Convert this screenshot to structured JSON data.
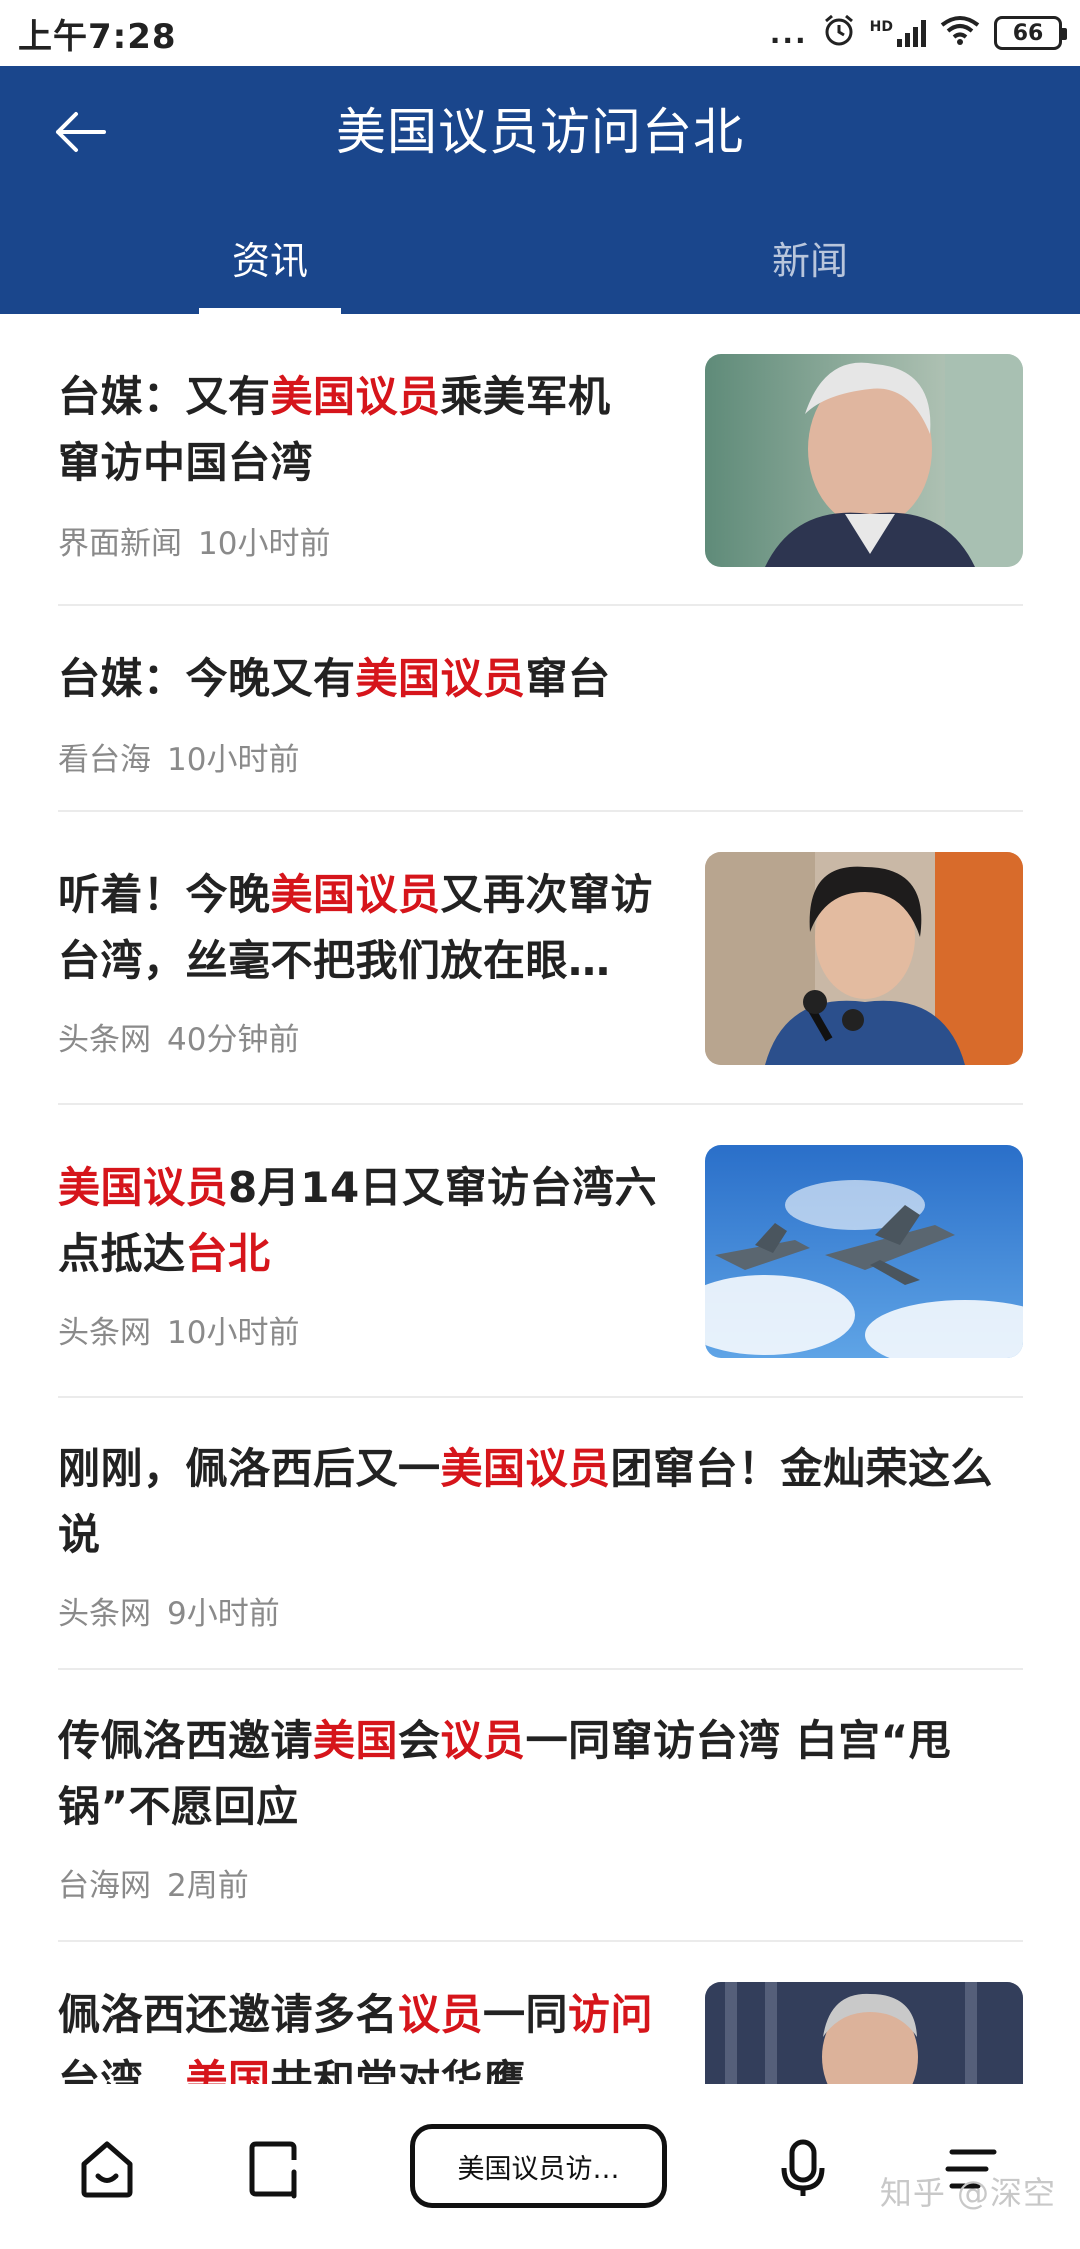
{
  "status": {
    "time": "上午7:28",
    "dots": "...",
    "hd": "HD",
    "battery": "66"
  },
  "header": {
    "title": "美国议员访问台北"
  },
  "tabs": [
    {
      "label": "资讯"
    },
    {
      "label": "新闻"
    }
  ],
  "items": [
    {
      "title_parts": [
        {
          "t": "台媒：又有",
          "h": false
        },
        {
          "t": "美国议员",
          "h": true
        },
        {
          "t": "乘美军机窜访中国台湾",
          "h": false
        }
      ],
      "source": "界面新闻",
      "time": "10小时前"
    },
    {
      "title_parts": [
        {
          "t": "台媒：今晚又有",
          "h": false
        },
        {
          "t": "美国议员",
          "h": true
        },
        {
          "t": "窜台",
          "h": false
        }
      ],
      "source": "看台海",
      "time": "10小时前"
    },
    {
      "title_parts": [
        {
          "t": "听着！今晚",
          "h": false
        },
        {
          "t": "美国议员",
          "h": true
        },
        {
          "t": "又再次窜访台湾，丝毫不把我们放在眼…",
          "h": false
        }
      ],
      "source": "头条网",
      "time": "40分钟前"
    },
    {
      "title_parts": [
        {
          "t": "美国议员",
          "h": true
        },
        {
          "t": "8月14日又窜访台湾六点抵达",
          "h": false
        },
        {
          "t": "台北",
          "h": true
        }
      ],
      "source": "头条网",
      "time": "10小时前"
    },
    {
      "title_parts": [
        {
          "t": "刚刚，佩洛西后又一",
          "h": false
        },
        {
          "t": "美国议员",
          "h": true
        },
        {
          "t": "团窜台！金灿荣这么说",
          "h": false
        }
      ],
      "source": "头条网",
      "time": "9小时前"
    },
    {
      "title_parts": [
        {
          "t": "传佩洛西邀请",
          "h": false
        },
        {
          "t": "美国",
          "h": true
        },
        {
          "t": "会",
          "h": false
        },
        {
          "t": "议员",
          "h": true
        },
        {
          "t": "一同窜访台湾 白宫“甩锅”不愿回应",
          "h": false
        }
      ],
      "source": "台海网",
      "time": "2周前"
    },
    {
      "title_parts": [
        {
          "t": "佩洛西还邀请多名",
          "h": false
        },
        {
          "t": "议员",
          "h": true
        },
        {
          "t": "一同",
          "h": false
        },
        {
          "t": "访问",
          "h": true
        },
        {
          "t": "台湾，",
          "h": false
        },
        {
          "t": "美国",
          "h": true
        },
        {
          "t": "共和党对华鹰",
          "h": false
        }
      ],
      "source": "",
      "time": ""
    }
  ],
  "bottom": {
    "search_text": "美国议员访…",
    "watermark": "知乎 @深空"
  },
  "colors": {
    "header": "#1a468c",
    "highlight": "#d6151b"
  }
}
